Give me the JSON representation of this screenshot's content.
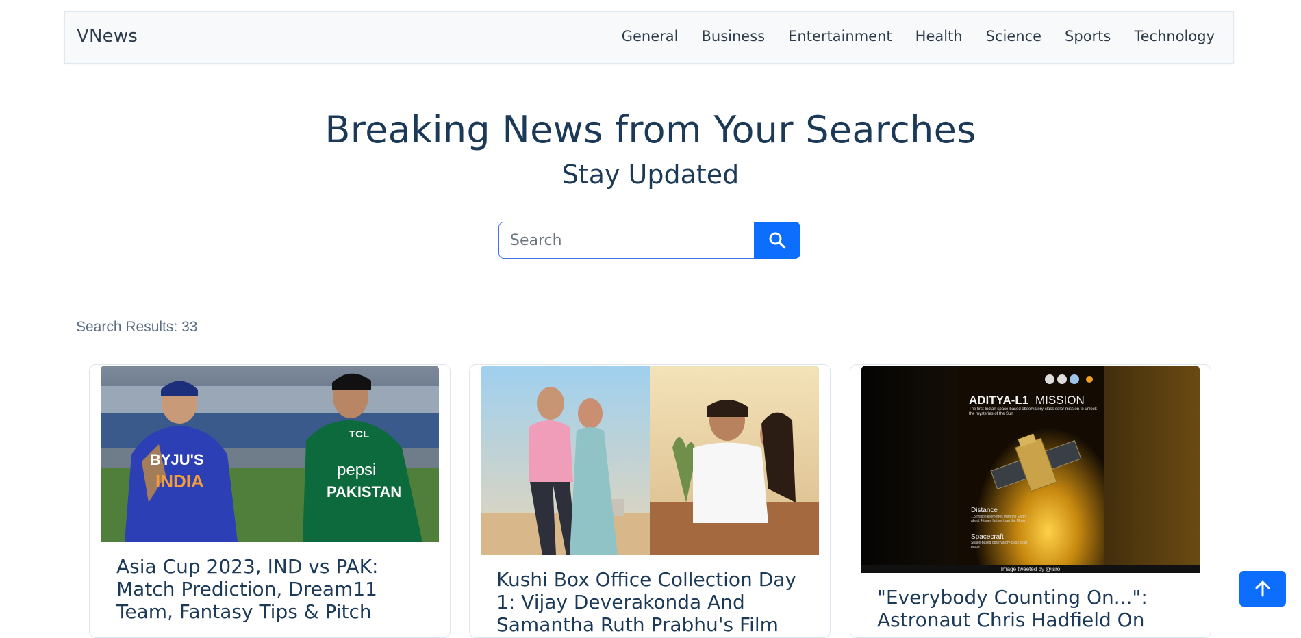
{
  "navbar": {
    "brand": "VNews",
    "links": [
      "General",
      "Business",
      "Entertainment",
      "Health",
      "Science",
      "Sports",
      "Technology"
    ]
  },
  "hero": {
    "title": "Breaking News from Your Searches",
    "subtitle": "Stay Updated"
  },
  "search": {
    "placeholder": "Search",
    "value": "",
    "button_icon": "search-icon"
  },
  "results": {
    "count_label": "Search Results: 33"
  },
  "cards": [
    {
      "title": "Asia Cup 2023, IND vs PAK: Match Prediction, Dream11 Team, Fantasy Tips & Pitch",
      "image_text": {
        "jersey_left_sponsor": "BYJU'S",
        "jersey_left_team": "INDIA",
        "jersey_right_sponsor": "pepsi",
        "jersey_right_team": "PAKISTAN",
        "jersey_right_top": "TCL"
      }
    },
    {
      "title": "Kushi Box Office Collection Day 1: Vijay Deverakonda And Samantha Ruth Prabhu's Film",
      "image_text": {}
    },
    {
      "title": "\"Everybody Counting On...\": Astronaut Chris Hadfield On",
      "image_text": {
        "mission": "ADITYA-L1",
        "mission_suffix": "MISSION",
        "mission_desc": "The first Indian space-based observatory-class solar mission to unlock the mysteries of the Sun",
        "distance_label": "Distance",
        "distance_desc": "1.5 million kilometres from the Earth, about 4 times farther than the Moon",
        "spacecraft_label": "Spacecraft",
        "spacecraft_desc": "Space-based observatory-class solar probe",
        "credit": "Image tweeted by @isro"
      }
    }
  ],
  "back_to_top": {
    "icon": "arrow-up-icon"
  },
  "colors": {
    "primary": "#0d6efd",
    "heading": "#1c3a58",
    "navbar_bg": "#f7f9fb"
  }
}
